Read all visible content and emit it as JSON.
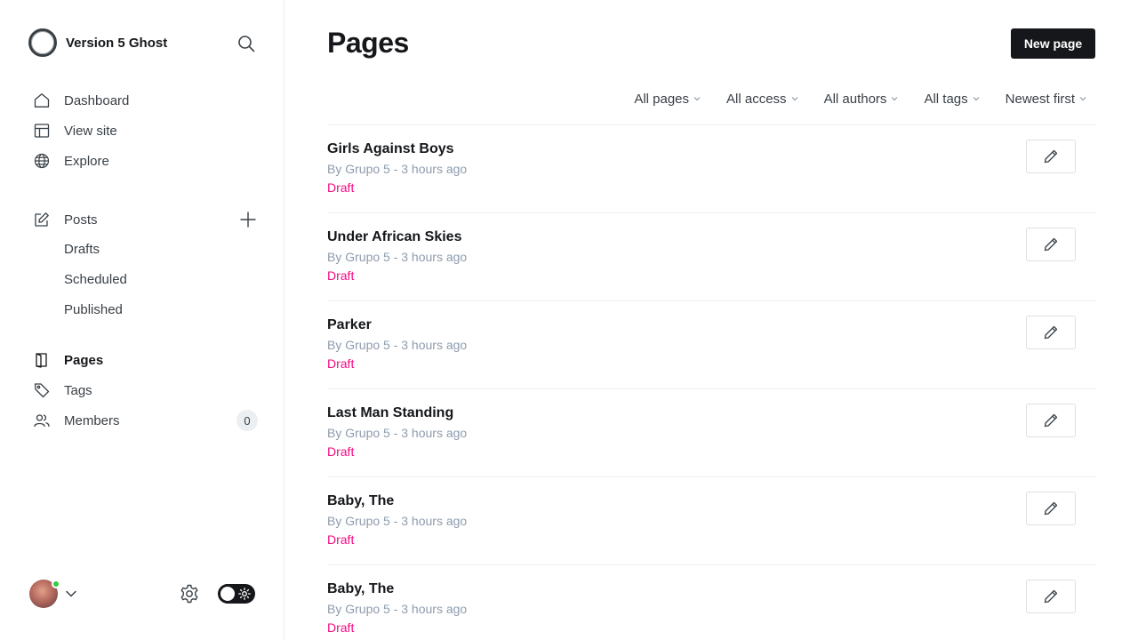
{
  "brand": {
    "name": "Version 5 Ghost"
  },
  "nav": {
    "dashboard": "Dashboard",
    "view_site": "View site",
    "explore": "Explore",
    "posts": "Posts",
    "drafts": "Drafts",
    "scheduled": "Scheduled",
    "published": "Published",
    "pages": "Pages",
    "tags": "Tags",
    "members": "Members",
    "members_count": "0"
  },
  "header": {
    "title": "Pages",
    "new_button": "New page"
  },
  "filters": [
    "All pages",
    "All access",
    "All authors",
    "All tags",
    "Newest first"
  ],
  "pages": [
    {
      "title": "Girls Against Boys",
      "meta": "By Grupo 5 - 3 hours ago",
      "status": "Draft"
    },
    {
      "title": "Under African Skies",
      "meta": "By Grupo 5 - 3 hours ago",
      "status": "Draft"
    },
    {
      "title": "Parker",
      "meta": "By Grupo 5 - 3 hours ago",
      "status": "Draft"
    },
    {
      "title": "Last Man Standing",
      "meta": "By Grupo 5 - 3 hours ago",
      "status": "Draft"
    },
    {
      "title": "Baby, The",
      "meta": "By Grupo 5 - 3 hours ago",
      "status": "Draft"
    },
    {
      "title": "Baby, The",
      "meta": "By Grupo 5 - 3 hours ago",
      "status": "Draft"
    }
  ],
  "colors": {
    "accent_dark": "#15171a",
    "draft": "#f50b84",
    "online": "#30cf43"
  }
}
